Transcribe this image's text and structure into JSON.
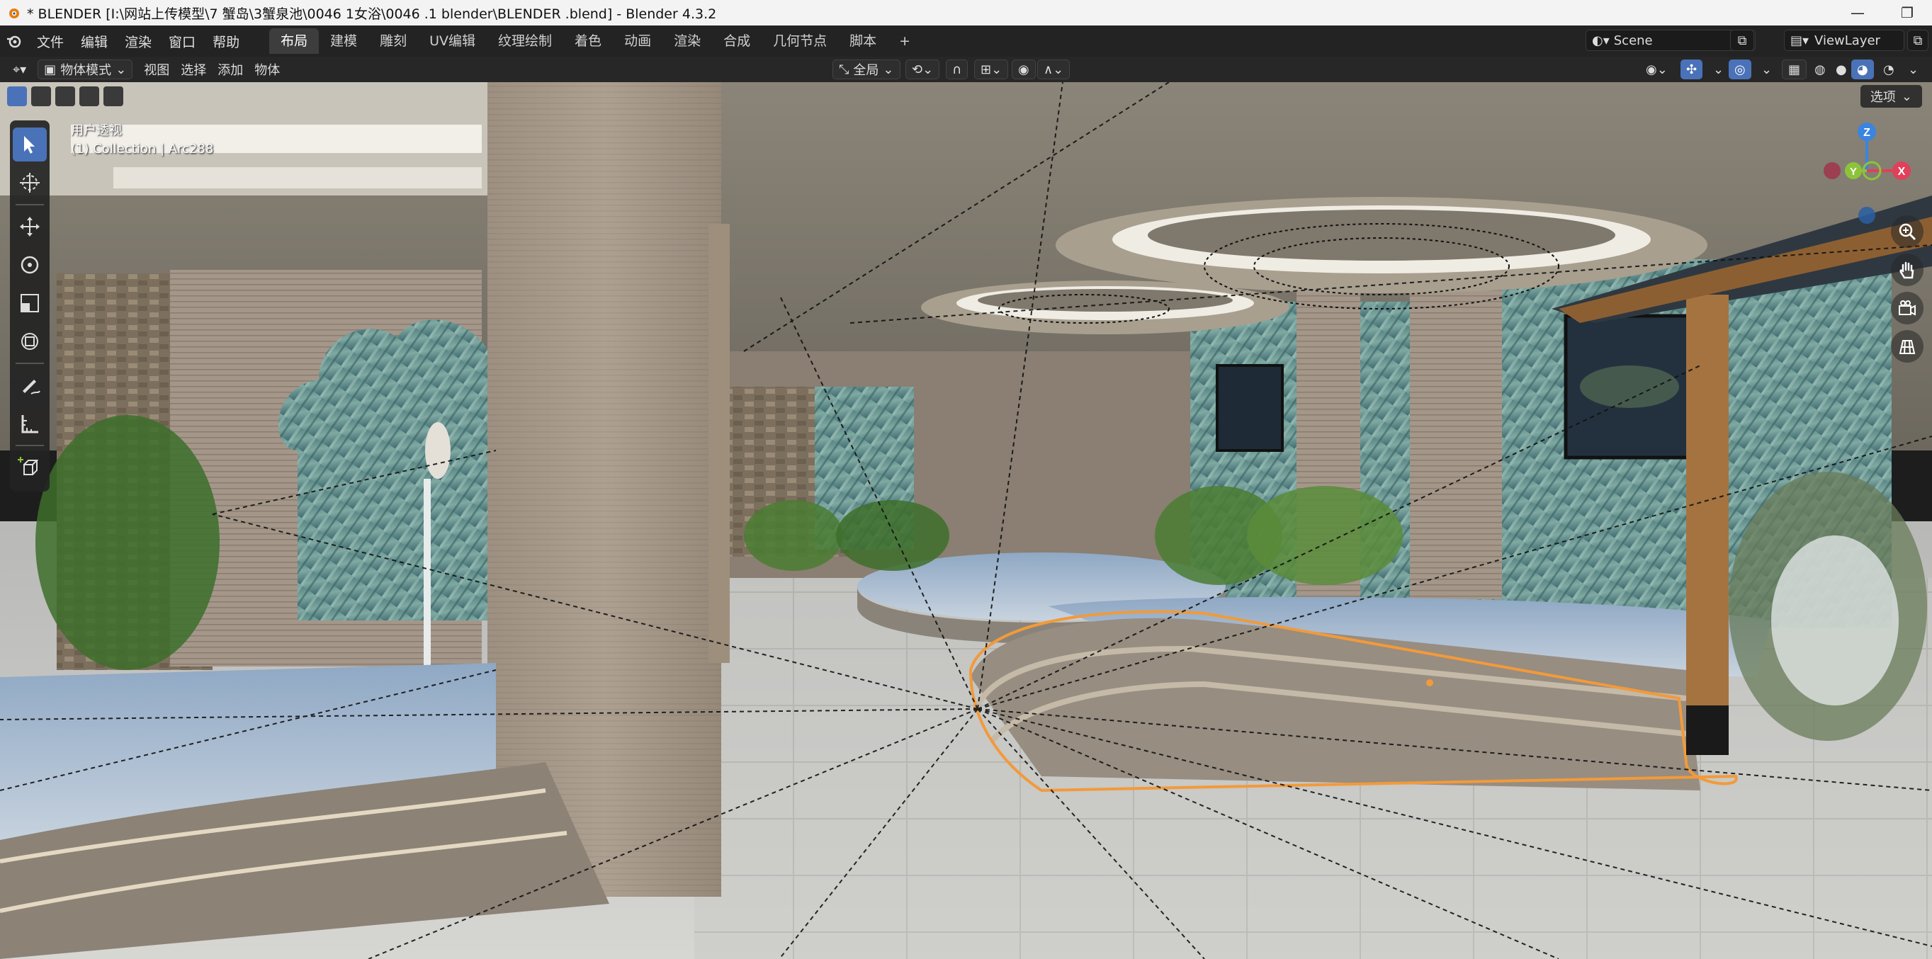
{
  "window": {
    "title": "* BLENDER  [I:\\网站上传模型\\7 蟹岛\\3蟹泉池\\0046 1女浴\\0046 .1 blender\\BLENDER .blend] - Blender 4.3.2",
    "minimize": "—",
    "restore": "❐"
  },
  "menu": [
    "文件",
    "编辑",
    "渲染",
    "窗口",
    "帮助"
  ],
  "workspace_tabs": [
    "布局",
    "建模",
    "雕刻",
    "UV编辑",
    "纹理绘制",
    "着色",
    "动画",
    "渲染",
    "合成",
    "几何节点",
    "脚本"
  ],
  "active_workspace": "布局",
  "add_tab": "+",
  "scene": {
    "name": "Scene"
  },
  "view_layer": {
    "name": "ViewLayer"
  },
  "header": {
    "mode": "物体模式",
    "view": "视图",
    "select": "选择",
    "add": "添加",
    "object": "物体",
    "transform_orientation": "全局"
  },
  "viewport": {
    "view_name": "用户透视",
    "collection_info": "(1) Collection | Arc288",
    "options": "选项"
  },
  "gizmo": {
    "x": "X",
    "y": "Y",
    "z": "Z"
  },
  "colors": {
    "accent": "#4a72b8",
    "selection": "#f29a3a",
    "axis_x": "#e0405a",
    "axis_y": "#8bc43a",
    "axis_z": "#3b84e0"
  },
  "tools": [
    "select-box-icon",
    "cursor-icon",
    "move-icon",
    "rotate-icon",
    "scale-icon",
    "transform-icon",
    "annotate-icon",
    "measure-icon",
    "add-cube-icon"
  ],
  "nav": [
    "zoom-icon",
    "hand-pan-icon",
    "camera-icon",
    "grid-icon"
  ]
}
